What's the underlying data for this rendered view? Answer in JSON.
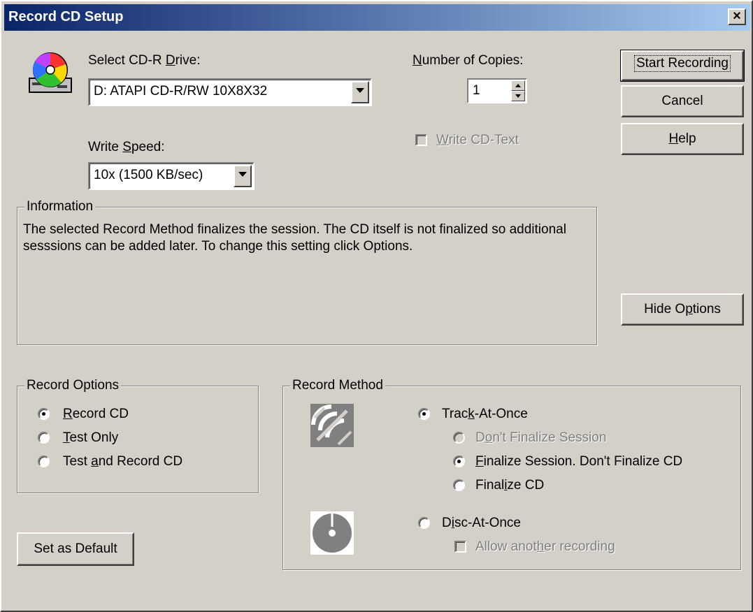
{
  "window": {
    "title": "Record CD Setup",
    "close_glyph": "×"
  },
  "drive": {
    "label_pre": "Select CD-R ",
    "label_key": "D",
    "label_post": "rive:",
    "value": "D: ATAPI CD-R/RW 10X8X32"
  },
  "speed": {
    "label_pre": "Write ",
    "label_key": "S",
    "label_post": "peed:",
    "value": "10x (1500 KB/sec)"
  },
  "copies": {
    "label_key": "N",
    "label_post": "umber of Copies:",
    "value": "1"
  },
  "cdtext": {
    "label_key": "W",
    "label_post": "rite CD-Text",
    "checked": false,
    "enabled": false
  },
  "buttons": {
    "start": "Start Recording",
    "cancel": "Cancel",
    "help_key": "H",
    "help_post": "elp",
    "hide_pre": "Hide O",
    "hide_key": "p",
    "hide_post": "tions",
    "set_default": "Set as Default"
  },
  "information": {
    "legend": "Information",
    "text": "The selected Record Method finalizes the session. The CD itself is not finalized so additional sesssions can be added later. To change this setting click Options."
  },
  "record_options": {
    "legend": "Record Options",
    "items": [
      {
        "pre": "",
        "key": "R",
        "post": "ecord CD",
        "selected": true
      },
      {
        "pre": "",
        "key": "T",
        "post": "est Only",
        "selected": false
      },
      {
        "pre": "Test ",
        "key": "a",
        "post": "nd Record CD",
        "selected": false
      }
    ]
  },
  "record_method": {
    "legend": "Record Method",
    "tao": {
      "pre": "Trac",
      "key": "k",
      "post": "-At-Once",
      "selected": true
    },
    "tao_options": [
      {
        "pre": "D",
        "key": "o",
        "post": "n't Finalize Session",
        "selected": false,
        "enabled": false
      },
      {
        "pre": "",
        "key": "F",
        "post": "inalize Session. Don't Finalize CD",
        "selected": true,
        "enabled": true
      },
      {
        "pre": "Final",
        "key": "i",
        "post": "ze CD",
        "selected": false,
        "enabled": true
      }
    ],
    "dao": {
      "pre": "D",
      "key": "i",
      "post": "sc-At-Once",
      "selected": false
    },
    "allow": {
      "pre": "Allow anot",
      "key": "h",
      "post": "er recording",
      "checked": false,
      "enabled": false
    }
  },
  "icons": {
    "drive": "cd-drive-icon",
    "tao": "track-at-once-icon",
    "dao": "disc-at-once-icon"
  }
}
